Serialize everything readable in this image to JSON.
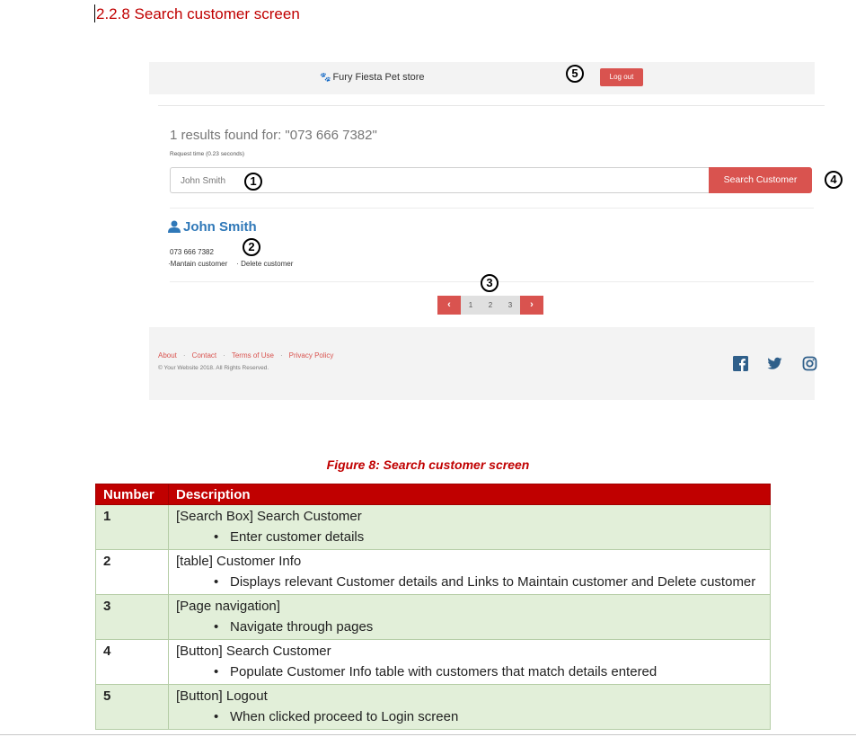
{
  "heading": "2.2.8 Search customer screen",
  "screen": {
    "brand": "Fury Fiesta Pet store",
    "logout_label": "Log out",
    "results_text": "1 results found for: \"073 666 7382\"",
    "request_time": "Request time (0.23 seconds)",
    "search_value": "John Smith",
    "search_button": "Search Customer",
    "customer": {
      "name": "John Smith",
      "phone": "073 666 7382",
      "maintain_link": "·Mantain customer",
      "delete_link": "· Delete customer"
    },
    "pager": {
      "prev": "‹",
      "pages": [
        "1",
        "2",
        "3"
      ],
      "next": "›"
    },
    "footer": {
      "links": [
        "About",
        "Contact",
        "Terms of Use",
        "Privacy Policy"
      ],
      "separator": "·",
      "copyright": "© Your Website 2018. All Rights Reserved.",
      "social_icons": [
        "facebook-icon",
        "twitter-icon",
        "instagram-icon"
      ]
    },
    "markers": [
      "1",
      "2",
      "3",
      "4",
      "5"
    ]
  },
  "caption": "Figure 8: Search customer screen",
  "table": {
    "headers": [
      "Number",
      "Description"
    ],
    "rows": [
      {
        "number": "1",
        "title": "[Search Box] Search Customer",
        "bullet": "Enter customer details"
      },
      {
        "number": "2",
        "title": "[table] Customer Info",
        "bullet": "Displays relevant Customer details and Links to Maintain customer and Delete customer"
      },
      {
        "number": "3",
        "title": "[Page navigation]",
        "bullet": "Navigate through pages"
      },
      {
        "number": "4",
        "title": "[Button] Search Customer",
        "bullet": "Populate Customer Info table with customers that match details entered"
      },
      {
        "number": "5",
        "title": "[Button] Logout",
        "bullet": "When clicked proceed to Login screen"
      }
    ]
  },
  "colors": {
    "accent_red": "#c00000",
    "button_red": "#d9534f",
    "link_blue": "#2f78b8",
    "row_green": "#e2efd9"
  }
}
